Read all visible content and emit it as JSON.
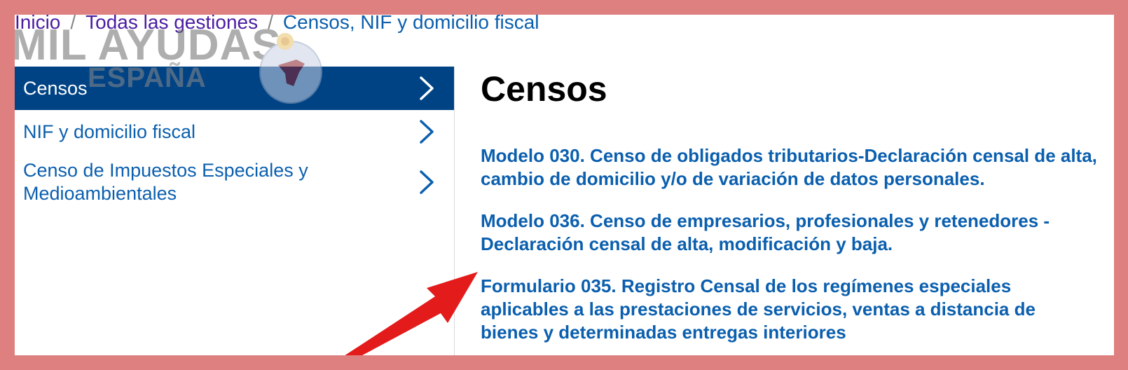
{
  "breadcrumb": {
    "items": [
      "Inicio",
      "Todas las gestiones",
      "Censos, NIF y domicilio fiscal"
    ],
    "separator": "/"
  },
  "watermark": {
    "text": "MIL AYUDAS",
    "subtext": "ESPAÑA"
  },
  "sidebar": {
    "items": [
      {
        "label": "Censos",
        "active": true
      },
      {
        "label": "NIF y domicilio fiscal",
        "active": false
      },
      {
        "label": "Censo de Impuestos Especiales y Medioambientales",
        "active": false
      }
    ]
  },
  "main": {
    "title": "Censos",
    "links": [
      "Modelo 030. Censo de obligados tributarios-Declaración censal de alta, cambio de domicilio y/o de variación de datos personales.",
      "Modelo 036. Censo de empresarios, profesionales y retenedores - Declaración censal de alta, modificación y baja.",
      "Formulario 035. Registro Censal de los regímenes especiales aplicables a las prestaciones de servicios, ventas a distancia de bienes y determinadas entregas interiores"
    ]
  },
  "colors": {
    "frame": "#df8080",
    "link": "#0b5fae",
    "visited": "#4b1ca2",
    "active_bg": "#004385",
    "arrow": "#e31b1b"
  },
  "icons": {
    "chevron": "chevron-right-icon",
    "arrow": "red-arrow-icon"
  }
}
